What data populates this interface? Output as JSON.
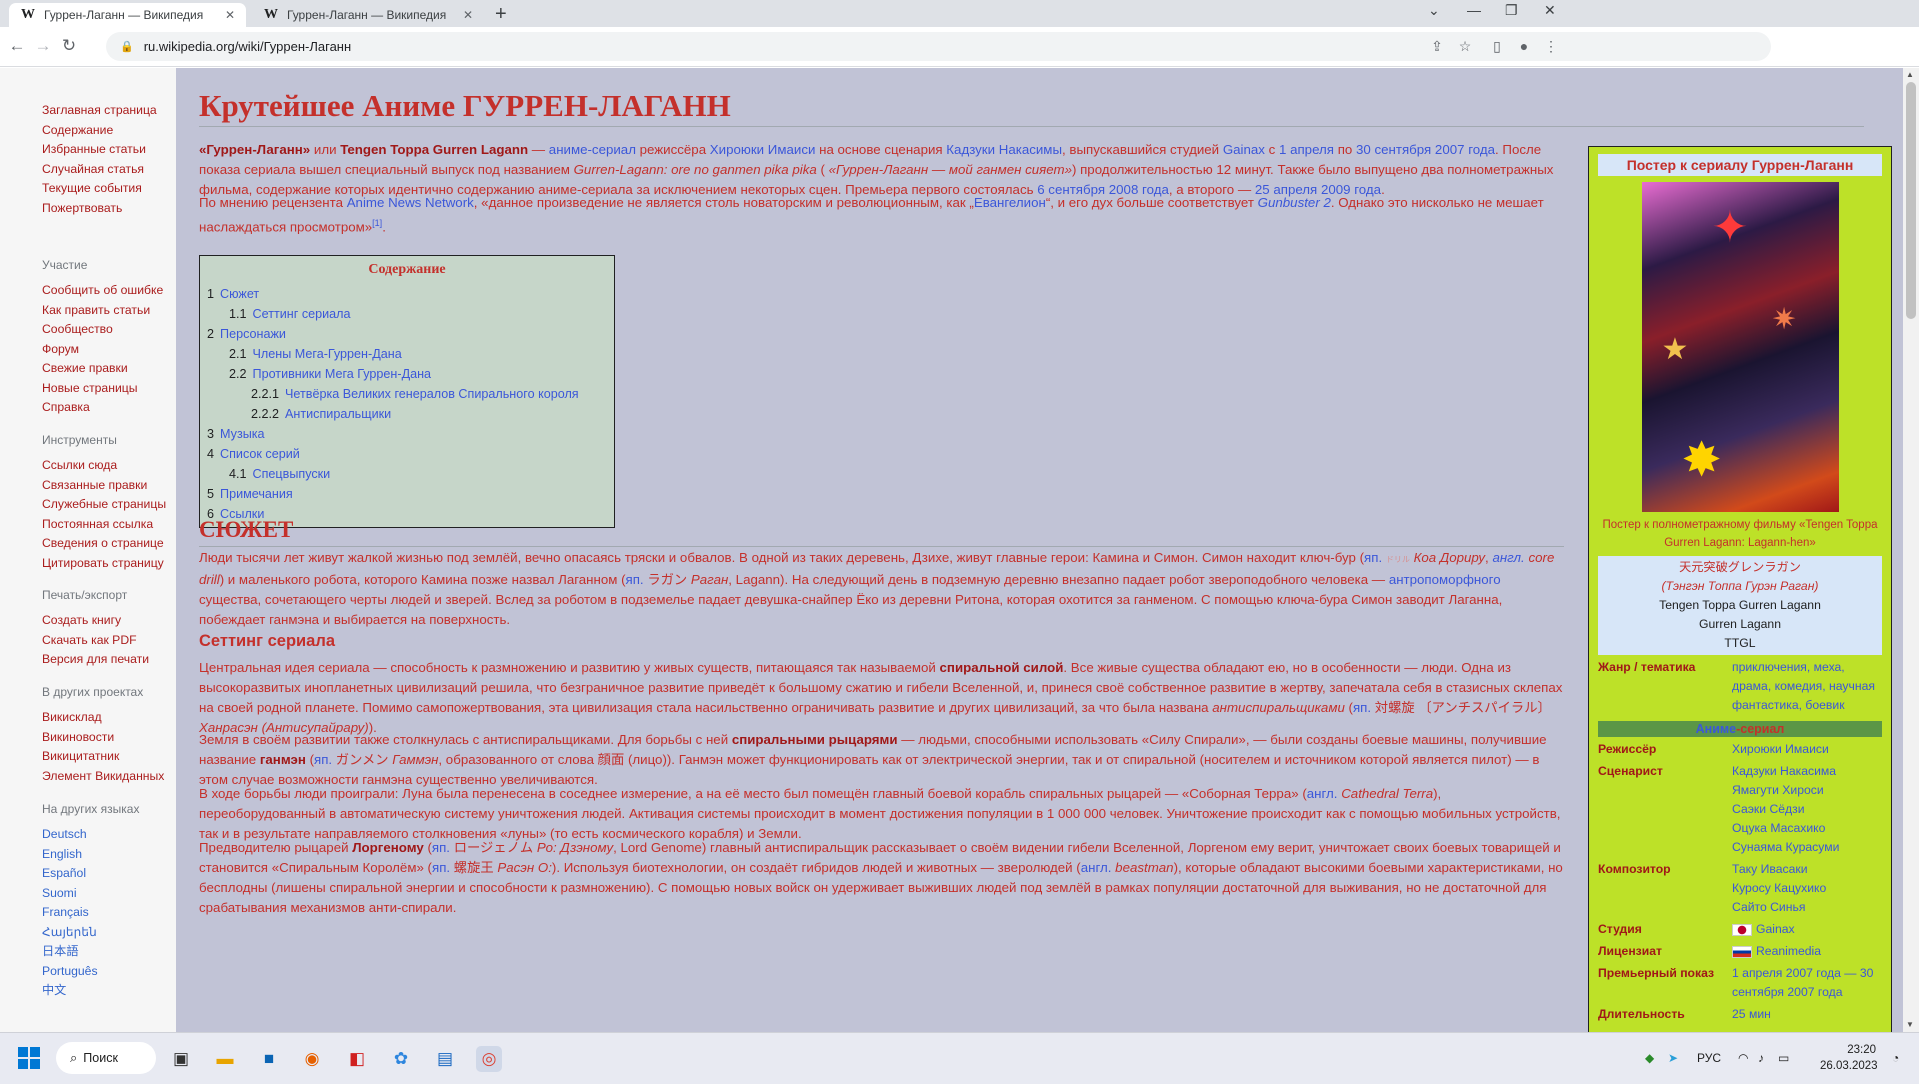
{
  "browser": {
    "tabs": [
      {
        "title": "Гуррен-Лаганн — Википедия",
        "favicon": "W"
      },
      {
        "title": "Гуррен-Лаганн — Википедия",
        "favicon": "W"
      }
    ],
    "url": "ru.wikipedia.org/wiki/Гуррен-Лаганн"
  },
  "sidebar": {
    "nav": [
      "Заглавная страница",
      "Содержание",
      "Избранные статьи",
      "Случайная статья",
      "Текущие события",
      "Пожертвовать"
    ],
    "participation": {
      "heading": "Участие",
      "items": [
        "Сообщить об ошибке",
        "Как править статьи",
        "Сообщество",
        "Форум",
        "Свежие правки",
        "Новые страницы",
        "Справка"
      ]
    },
    "tools": {
      "heading": "Инструменты",
      "items": [
        "Ссылки сюда",
        "Связанные правки",
        "Служебные страницы",
        "Постоянная ссылка",
        "Сведения о странице",
        "Цитировать страницу"
      ]
    },
    "print": {
      "heading": "Печать/экспорт",
      "items": [
        "Создать книгу",
        "Скачать как PDF",
        "Версия для печати"
      ]
    },
    "projects": {
      "heading": "В других проектах",
      "items": [
        "Викисклад",
        "Викиновости",
        "Викицитатник",
        "Элемент Викиданных"
      ]
    },
    "languages": {
      "heading": "На других языках",
      "items": [
        "Deutsch",
        "English",
        "Español",
        "Suomi",
        "Français",
        "Հայերեն",
        "日本語",
        "Português",
        "中文"
      ]
    }
  },
  "article": {
    "title": "Крутейшее Аниме ГУРРЕН-ЛАГАНН",
    "intro": {
      "p1_b1": "«Гуррен-Лаганн»",
      "p1_t1": " или ",
      "p1_b2": "Tengen Toppa Gurren Lagann",
      "p1_t2": "  — ",
      "p1_l1": "аниме-сериал",
      "p1_t3": " режиссёра ",
      "p1_l2": "Хироюки Имаиси",
      "p1_t4": " на основе сценария ",
      "p1_l3": "Кадзуки Накасимы",
      "p1_t5": ", выпускавшийся студией ",
      "p1_l4": "Gainax",
      "p1_t6": " с ",
      "p1_l5": "1 апреля",
      "p1_t7": " по ",
      "p1_l6": "30 сентября",
      "p1_t8": " ",
      "p1_l7": "2007 года",
      "p1_t9": ". После показа сериала вышел специальный выпуск под названием ",
      "p1_i1": "Gurren-Lagann: ore no ganmen pika pika",
      "p1_t10": " ( ",
      "p1_i2": "«Гуррен-Лаганн — мой ганмен сияет»",
      "p1_t11": ") продолжительностью 12 минут. Также было выпущено два полнометражных фильма, содержание которых идентично содержанию аниме-сериала за исключением некоторых сцен. Премьера первого состоялась ",
      "p1_l8": "6 сентября",
      "p1_t12": " ",
      "p1_l9": "2008 года",
      "p1_t13": ", а второго — ",
      "p1_l10": "25 апреля",
      "p1_t14": " ",
      "p1_l11": "2009 года",
      "p1_t15": ".",
      "p2_t1": "По мнению рецензента ",
      "p2_l1": "Anime News Network",
      "p2_t2": ", «данное произведение не является столь новаторским и революционным, как „",
      "p2_l2": "Евангелион",
      "p2_t3": "“, и его дух больше соответствует ",
      "p2_l3": "Gunbuster 2",
      "p2_t4": ". Однако это нисколько не мешает наслаждаться просмотром»",
      "p2_ref": "[1]",
      "p2_t5": "."
    },
    "toc": {
      "heading": "Содержание",
      "items": [
        {
          "num": "1",
          "text": "Сюжет",
          "level": 0
        },
        {
          "num": "1.1",
          "text": "Сеттинг сериала",
          "level": 1
        },
        {
          "num": "2",
          "text": "Персонажи",
          "level": 0
        },
        {
          "num": "2.1",
          "text": "Члены Мега-Гуррен-Дана",
          "level": 1
        },
        {
          "num": "2.2",
          "text": "Противники Мега Гуррен-Дана",
          "level": 1
        },
        {
          "num": "2.2.1",
          "text": "Четвёрка Великих генералов Спирального короля",
          "level": 2
        },
        {
          "num": "2.2.2",
          "text": "Антиспиральщики",
          "level": 2
        },
        {
          "num": "3",
          "text": "Музыка",
          "level": 0
        },
        {
          "num": "4",
          "text": "Список серий",
          "level": 0
        },
        {
          "num": "4.1",
          "text": "Спецвыпуски",
          "level": 1
        },
        {
          "num": "5",
          "text": "Примечания",
          "level": 0
        },
        {
          "num": "6",
          "text": "Ссылки",
          "level": 0
        }
      ]
    },
    "plot": {
      "heading": "СЮЖЕТ",
      "t1": "Люди тысячи лет живут жалкой жизнью под землёй, вечно опасаясь тряски и обвалов. В одной из таких деревень, Дзихе, живут главные герои: Камина и Симон. Симон находит ключ-бур (",
      "l1": "яп.",
      "t2": " ",
      "jp1": "ドリル",
      "t3": " ",
      "i1": "Коа Дориру",
      "t4": ", ",
      "l2": "англ.",
      "t5": " ",
      "i2": "core drill",
      "t6": ") и маленького робота, которого Камина позже назвал Лаганном (",
      "l3": "яп.",
      "t7": " ラガン ",
      "i3": "Раган",
      "t8": ", Lagann). На следующий день в подземную деревню внезапно падает робот звероподобного человека — ",
      "l4": "антропоморфного",
      "t9": " существа, сочетающего черты людей и зверей. Вслед за роботом в подземелье падает девушка-снайпер Ёко из деревни Ритона, которая охотится за ганменом. С помощью ключа-бура Симон заводит Лаганна, побеждает ганмэна и выбирается на поверхность."
    },
    "setting": {
      "heading": "Сеттинг сериала",
      "p1_t1": "Центральная идея сериала — способность к размножению и развитию у живых существ, питающаяся так называемой ",
      "p1_b1": "спиральной силой",
      "p1_t2": ". Все живые существа обладают ею, но в особенности — люди. Одна из высокоразвитых инопланетных цивилизаций решила, что безграничное развитие приведёт к большому сжатию и гибели Вселенной, и, принеся своё собственное развитие в жертву, запечатала себя в стазисных склепах на своей родной планете. Помимо самопожертвования, эта цивилизация стала насильственно ограничивать развитие и других цивилизаций, за что была названа ",
      "p1_i1": "антиспиральщиками",
      "p1_t3": " (",
      "p1_l1": "яп.",
      "p1_t4": " 対螺旋 〔アンチスパイラル〕 ",
      "p1_i2": "Ханрасэн (Антисупайрару)",
      "p1_t5": ").",
      "p2_t1": "Земля в своём развитии также столкнулась с антиспиральщиками. Для борьбы с ней ",
      "p2_b1": "спиральными рыцарями",
      "p2_t2": " — людьми, способными использовать «Силу Спирали», — были созданы боевые машины, получившие название ",
      "p2_b2": "ганмэн",
      "p2_t3": " (",
      "p2_l1": "яп.",
      "p2_t4": " ガンメン ",
      "p2_i1": "Гаммэн",
      "p2_t5": ", образованного от слова 顔面 (лицо)). Ганмэн может функционировать как от электрической энергии, так и от спиральной (носителем и источником которой является пилот) — в этом случае возможности ганмэна существенно увеличиваются.",
      "p3_t1": "В ходе борьбы люди проиграли: Луна была перенесена в соседнее измерение, а на её место был помещён главный боевой корабль спиральных рыцарей — «Соборная Терра» (",
      "p3_l1": "англ.",
      "p3_t2": " ",
      "p3_i1": "Cathedral Terra",
      "p3_t3": "), переоборудованный в автоматическую систему уничтожения людей. Активация системы происходит в момент достижения популяции в 1 000 000 человек. Уничтожение происходит как с помощью мобильных устройств, так и в результате направляемого столкновения «луны» (то есть космического корабля) и Земли.",
      "p4_t1": "Предводителю рыцарей ",
      "p4_b1": "Лоргеному",
      "p4_t2": " (",
      "p4_l1": "яп.",
      "p4_t3": " ロージェノム ",
      "p4_i1": "Ро: Дзэному",
      "p4_t4": ", Lord Genome) главный антиспиральщик рассказывает о своём видении гибели Вселенной, Лоргеном ему верит, уничтожает своих боевых товарищей и становится «Спиральным Королём» (",
      "p4_l2": "яп.",
      "p4_t5": " 螺旋王 ",
      "p4_i2": "Расэн О:",
      "p4_t6": "). Используя биотехнологии, он создаёт гибридов людей и животных — зверолюдей (",
      "p4_l3": "англ.",
      "p4_t7": " ",
      "p4_i3": "beastman",
      "p4_t8": "), которые обладают высокими боевыми характеристиками, но бесплодны (лишены спиральной энергии и способности к размножению). С помощью новых войск он удерживает выживших людей под землёй в рамках популяции достаточной для выживания, но не достаточной для срабатывания механизмов анти-спирали."
    }
  },
  "infobox": {
    "title": "Постер к сериалу Гуррен-Лаганн",
    "poster_caption": "Постер к полнометражному фильму «Tengen Toppa Gurren Lagann: Lagann-hen»",
    "jp_name": "天元突破グレンラガン",
    "romaji": "(Тэнгэн Топпа Гурэн Раган)",
    "en_names": [
      "Tengen Toppa Gurren Lagann",
      "Gurren Lagann",
      "TTGL"
    ],
    "genre_label": "Жанр / тематика",
    "genre_value": "приключения, меха, драма, комедия, научная фантастика, боевик",
    "section_part1": "Аниме",
    "section_part2": "-сериал",
    "director_label": "Режиссёр",
    "director_value": "Хироюки Имаиси",
    "writer_label": "Сценарист",
    "writers": [
      "Кадзуки Накасима",
      "Ямагути Хироси",
      "Саэки Сёдзи",
      "Оцука Масахико",
      "Сунаяма Курасуми"
    ],
    "composer_label": "Композитор",
    "composers": [
      "Таку Ивасаки",
      "Куросу Кацухико",
      "Сайто Синья"
    ],
    "studio_label": "Студия",
    "studio_value": "Gainax",
    "license_label": "Лицензиат",
    "license_value": "Reanimedia",
    "premiere_label": "Премьерный показ",
    "premiere_value": "1 апреля 2007 года — 30 сентября 2007 года",
    "duration_label": "Длительность",
    "duration_value": "25 мин"
  },
  "taskbar": {
    "search_label": "Поиск",
    "lang": "РУС",
    "time": "23:20",
    "date": "26.03.2023"
  },
  "colors": {
    "content_bg": "#c1c3d6",
    "text_red": "#c4302b",
    "link_blue": "#3b57d9",
    "infobox_bg": "#bde128",
    "toc_bg": "#c6d6c9"
  }
}
